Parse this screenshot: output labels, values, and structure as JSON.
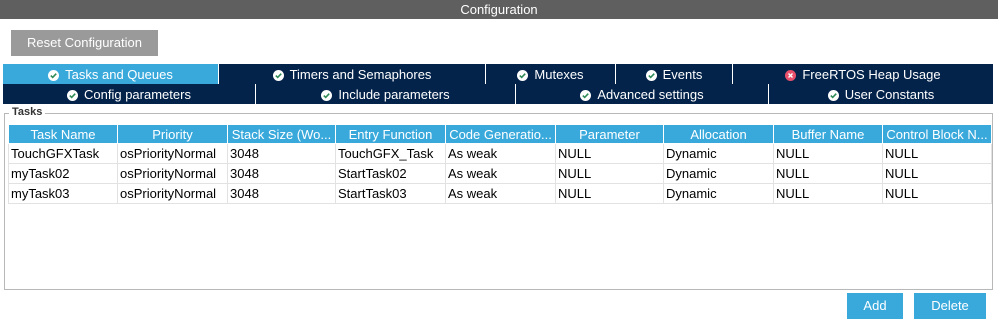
{
  "window": {
    "title": "Configuration"
  },
  "toolbar": {
    "reset_label": "Reset Configuration"
  },
  "tabs_row1": [
    {
      "label": "Tasks and Queues",
      "status": "ok",
      "active": true
    },
    {
      "label": "Timers and Semaphores",
      "status": "ok",
      "active": false
    },
    {
      "label": "Mutexes",
      "status": "ok",
      "active": false
    },
    {
      "label": "Events",
      "status": "ok",
      "active": false
    },
    {
      "label": "FreeRTOS Heap Usage",
      "status": "error",
      "active": false
    }
  ],
  "tabs_row2": [
    {
      "label": "Config parameters",
      "status": "ok",
      "active": false
    },
    {
      "label": "Include parameters",
      "status": "ok",
      "active": false
    },
    {
      "label": "Advanced settings",
      "status": "ok",
      "active": false
    },
    {
      "label": "User Constants",
      "status": "ok",
      "active": false
    }
  ],
  "tasks_group": {
    "title": "Tasks",
    "columns": [
      "Task Name",
      "Priority",
      "Stack Size (Wo...",
      "Entry Function",
      "Code Generatio...",
      "Parameter",
      "Allocation",
      "Buffer Name",
      "Control Block N..."
    ],
    "rows": [
      [
        "TouchGFXTask",
        "osPriorityNormal",
        "3048",
        "TouchGFX_Task",
        "As weak",
        "NULL",
        "Dynamic",
        "NULL",
        "NULL"
      ],
      [
        "myTask02",
        "osPriorityNormal",
        "3048",
        "StartTask02",
        "As weak",
        "NULL",
        "Dynamic",
        "NULL",
        "NULL"
      ],
      [
        "myTask03",
        "osPriorityNormal",
        "3048",
        "StartTask03",
        "As weak",
        "NULL",
        "Dynamic",
        "NULL",
        "NULL"
      ]
    ]
  },
  "actions": {
    "add_label": "Add",
    "delete_label": "Delete"
  },
  "colors": {
    "tab_dark": "#03234b",
    "accent": "#39a9dc",
    "ok": "#ffffff",
    "error": "#e8506b"
  }
}
